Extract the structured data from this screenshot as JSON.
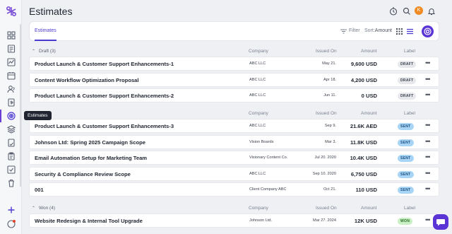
{
  "header": {
    "title": "Estimates",
    "avatar_initial": "K"
  },
  "toolbar": {
    "tab": "Estimates",
    "filter_label": "Filter",
    "sort_label": "Sort:",
    "sort_value": "Amount"
  },
  "sidebar": {
    "tooltip": "Estimates"
  },
  "columns": {
    "company": "Company",
    "issued": "Issued On",
    "amount": "Amount",
    "label": "Label"
  },
  "groups": [
    {
      "label": "Draft (3)",
      "rows": [
        {
          "title": "Product Launch & Customer Support Enhancements-1",
          "company": "ABC LLC",
          "issued": "May 21.",
          "amount": "9,600 USD",
          "badge": "DRAFT"
        },
        {
          "title": "Content Workflow Optimization Proposal",
          "company": "ABC LLC",
          "issued": "Apr 18.",
          "amount": "4,200 USD",
          "badge": "DRAFT"
        },
        {
          "title": "Product Launch & Customer Support Enhancements-2",
          "company": "ABC LLC",
          "issued": "Jun 11.",
          "amount": "0 USD",
          "badge": "DRAFT"
        }
      ]
    },
    {
      "label": "(5)",
      "rows": [
        {
          "title": "Product Launch & Customer Support Enhancements-3",
          "company": "ABC LLC",
          "issued": "Sep 9.",
          "amount": "21.6K AED",
          "badge": "SENT"
        },
        {
          "title": "Johnson Ltd: Spring 2025 Campaign Scope",
          "company": "Vision Boards",
          "issued": "Mar 3.",
          "amount": "11.8K USD",
          "badge": "SENT"
        },
        {
          "title": "Email Automation Setup for Marketing Team",
          "company": "Visionary Content Co.",
          "issued": "Jul 20. 2020",
          "amount": "10.4K USD",
          "badge": "SENT"
        },
        {
          "title": "Security & Compliance Review Scope",
          "company": "ABC LLC",
          "issued": "Sep 10. 2020",
          "amount": "6,750 USD",
          "badge": "SENT"
        },
        {
          "title": "001",
          "company": "Client Company ABC",
          "issued": "Oct 21.",
          "amount": "110 USD",
          "badge": "SENT"
        }
      ]
    },
    {
      "label": "Won (4)",
      "rows": [
        {
          "title": "Website Redesign & Internal Tool Upgrade",
          "company": "Johnson Ltd.",
          "issued": "Mar 27. 2024",
          "amount": "12K USD",
          "badge": "WON"
        }
      ]
    }
  ],
  "colors": {
    "accent": "#4b3ad0",
    "brand": "#5b34d6"
  }
}
